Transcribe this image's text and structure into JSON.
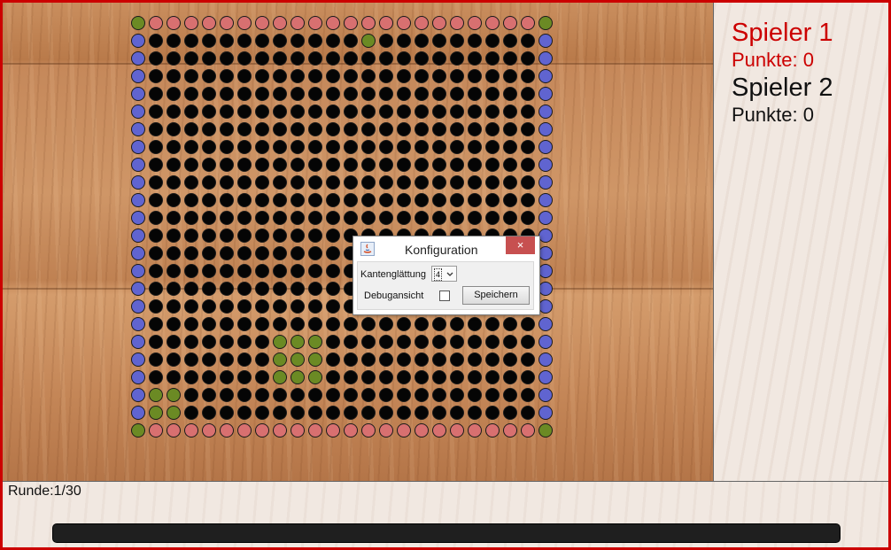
{
  "players": [
    {
      "name": "Spieler 1",
      "points": "Punkte: 0",
      "color": "#cc0000"
    },
    {
      "name": "Spieler 2",
      "points": "Punkte: 0",
      "color": "#111111"
    }
  ],
  "round": "Runde:1/30",
  "dialog": {
    "title": "Konfiguration",
    "close_icon": "×",
    "antialias_label": "Kantenglättung",
    "antialias_value": "4",
    "debug_label": "Debugansicht",
    "debug_checked": false,
    "save_label": "Speichern",
    "icon": "java-icon"
  },
  "board": {
    "rows": 24,
    "cols": 24,
    "colors": {
      "black": "#050505",
      "red": "#d87070",
      "blue": "#6064d0",
      "green": "#6b8a24"
    },
    "corners": "green",
    "top_bottom_edges": "red",
    "left_right_edges": "blue",
    "interior": "black",
    "green_cells": [
      [
        1,
        13
      ],
      [
        18,
        8
      ],
      [
        18,
        9
      ],
      [
        18,
        10
      ],
      [
        19,
        8
      ],
      [
        19,
        9
      ],
      [
        19,
        10
      ],
      [
        20,
        8
      ],
      [
        20,
        9
      ],
      [
        20,
        10
      ],
      [
        21,
        1
      ],
      [
        21,
        2
      ],
      [
        22,
        1
      ],
      [
        22,
        2
      ]
    ]
  }
}
